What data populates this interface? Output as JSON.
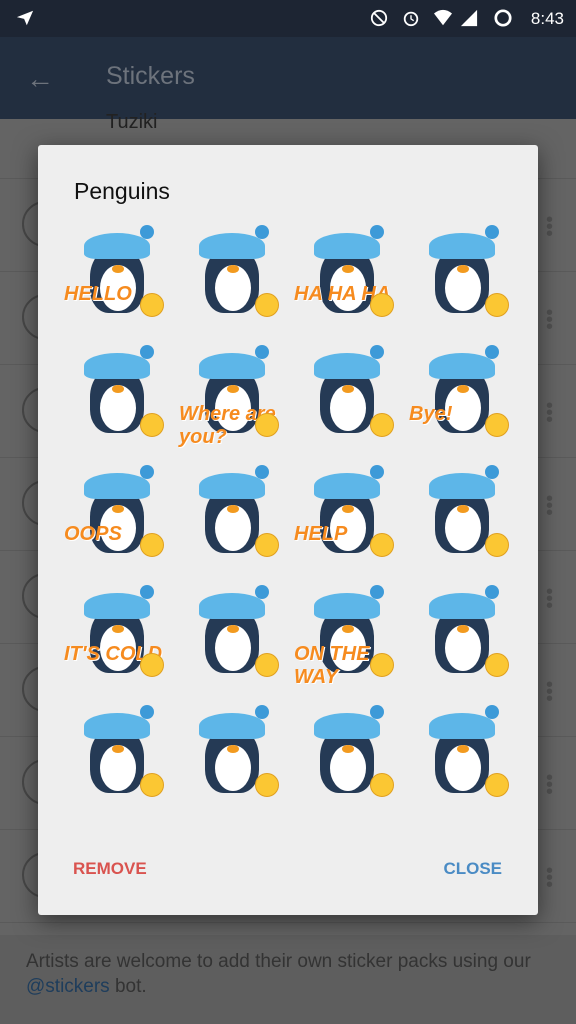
{
  "status_bar": {
    "time": "8:43",
    "icons": [
      "telegram-icon",
      "dnd-icon",
      "alarm-icon",
      "wifi-icon",
      "signal-icon",
      "battery-icon"
    ]
  },
  "app_bar": {
    "title": "Stickers",
    "back_icon": "arrow-left-icon"
  },
  "background_list": {
    "first_item_name": "Tuziki",
    "row_count": 9
  },
  "footer": {
    "text_before": "Artists are welcome to add their own sticker packs using our ",
    "link": "@stickers",
    "text_after": " bot."
  },
  "dialog": {
    "title": "Penguins",
    "remove_label": "REMOVE",
    "close_label": "CLOSE",
    "colors": {
      "remove": "#d9534f",
      "close": "#4a8bc4"
    },
    "stickers": [
      {
        "caption": "HELLO",
        "emoji": "waving-hand"
      },
      {
        "caption": "",
        "emoji": "blush"
      },
      {
        "caption": "HA HA HA",
        "emoji": "joy"
      },
      {
        "caption": "",
        "emoji": "tongue-wink"
      },
      {
        "caption": "",
        "emoji": "kiss"
      },
      {
        "caption": "Where are you?",
        "emoji": "pensive"
      },
      {
        "caption": "",
        "emoji": "heart-eyes"
      },
      {
        "caption": "Bye!",
        "emoji": "raised-hand"
      },
      {
        "caption": "OOPS",
        "emoji": "sweat"
      },
      {
        "caption": "",
        "emoji": "sob"
      },
      {
        "caption": "HELP",
        "emoji": "confounded"
      },
      {
        "caption": "",
        "emoji": "disappointed"
      },
      {
        "caption": "IT'S COLD",
        "emoji": "see-no-evil-monkey"
      },
      {
        "caption": "",
        "emoji": "cry"
      },
      {
        "caption": "ON THE WAY",
        "emoji": "sunglasses"
      },
      {
        "caption": "",
        "emoji": "scream"
      },
      {
        "caption": "",
        "emoji": "angry"
      },
      {
        "caption": "",
        "emoji": "rage"
      },
      {
        "caption": "",
        "emoji": "imp"
      },
      {
        "caption": "",
        "emoji": "persevere"
      }
    ]
  }
}
